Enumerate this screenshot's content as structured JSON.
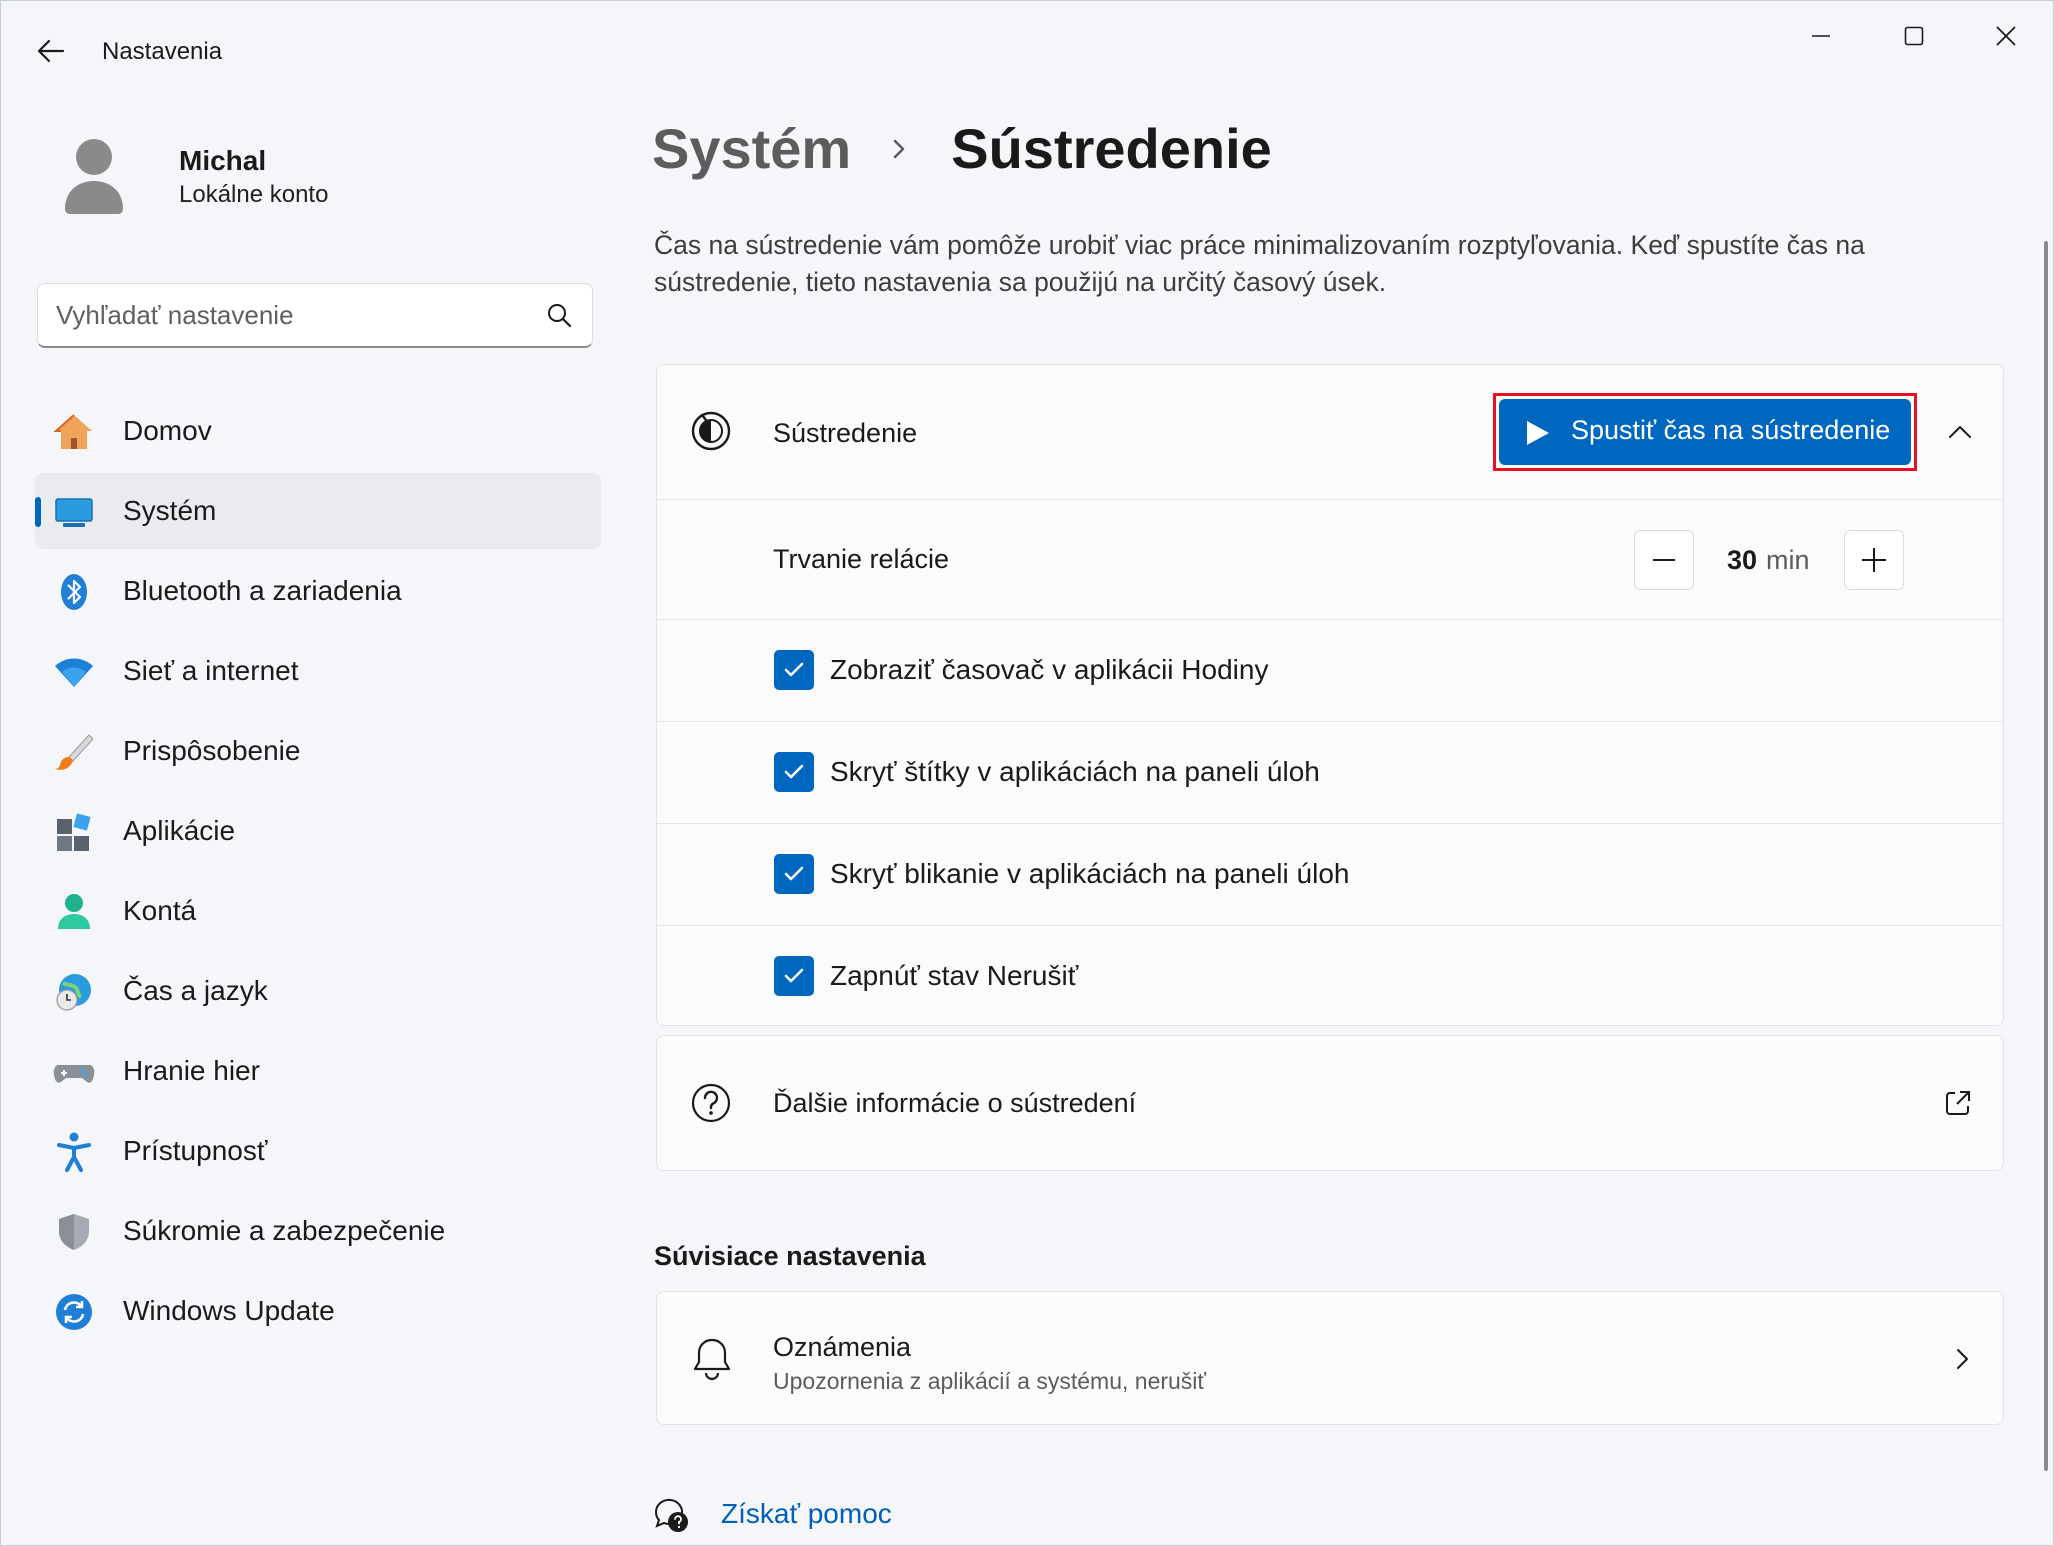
{
  "window": {
    "title": "Nastavenia"
  },
  "user": {
    "name": "Michal",
    "account_type": "Lokálne konto"
  },
  "search": {
    "placeholder": "Vyhľadať nastavenie"
  },
  "sidebar": {
    "items": [
      {
        "label": "Domov",
        "icon": "home-icon"
      },
      {
        "label": "Systém",
        "icon": "system-icon",
        "active": true
      },
      {
        "label": "Bluetooth a zariadenia",
        "icon": "bluetooth-icon"
      },
      {
        "label": "Sieť a internet",
        "icon": "wifi-icon"
      },
      {
        "label": "Prispôsobenie",
        "icon": "brush-icon"
      },
      {
        "label": "Aplikácie",
        "icon": "apps-icon"
      },
      {
        "label": "Kontá",
        "icon": "account-icon"
      },
      {
        "label": "Čas a jazyk",
        "icon": "globe-clock-icon"
      },
      {
        "label": "Hranie hier",
        "icon": "gamepad-icon"
      },
      {
        "label": "Prístupnosť",
        "icon": "accessibility-icon"
      },
      {
        "label": "Súkromie a zabezpečenie",
        "icon": "shield-icon"
      },
      {
        "label": "Windows Update",
        "icon": "update-icon"
      }
    ]
  },
  "breadcrumb": {
    "parent": "Systém",
    "current": "Sústredenie"
  },
  "description": "Čas na sústredenie vám pomôže urobiť viac práce minimalizovaním rozptyľovania. Keď spustíte čas na sústredenie, tieto nastavenia sa použijú na určitý časový úsek.",
  "focus_card": {
    "title": "Sústredenie",
    "start_button": "Spustiť čas na sústredenie",
    "duration_label": "Trvanie relácie",
    "duration_value": "30",
    "duration_unit": "min",
    "options": [
      {
        "label": "Zobraziť časovač v aplikácii Hodiny",
        "checked": true
      },
      {
        "label": "Skryť štítky v aplikáciách na paneli úloh",
        "checked": true
      },
      {
        "label": "Skryť blikanie v aplikáciách na paneli úloh",
        "checked": true
      },
      {
        "label": "Zapnúť stav Nerušiť",
        "checked": true
      }
    ]
  },
  "more_info": {
    "label": "Ďalšie informácie o sústredení"
  },
  "related": {
    "title": "Súvisiace nastavenia",
    "items": [
      {
        "title": "Oznámenia",
        "subtitle": "Upozornenia z aplikácií a systému, nerušiť"
      }
    ]
  },
  "help": {
    "label": "Získať pomoc"
  },
  "colors": {
    "accent": "#0067c0",
    "highlight_outline": "#e81123"
  }
}
